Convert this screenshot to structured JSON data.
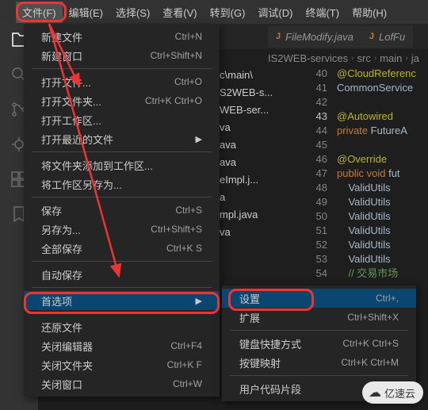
{
  "menubar": {
    "items": [
      "文件(F)",
      "编辑(E)",
      "选择(S)",
      "查看(V)",
      "转到(G)",
      "调试(D)",
      "终端(T)",
      "帮助(H)"
    ]
  },
  "fileMenu": {
    "groups": [
      [
        {
          "label": "新建文件",
          "shortcut": "Ctrl+N"
        },
        {
          "label": "新建窗口",
          "shortcut": "Ctrl+Shift+N"
        }
      ],
      [
        {
          "label": "打开文件...",
          "shortcut": "Ctrl+O"
        },
        {
          "label": "打开文件夹...",
          "shortcut": "Ctrl+K Ctrl+O"
        },
        {
          "label": "打开工作区...",
          "shortcut": ""
        },
        {
          "label": "打开最近的文件",
          "shortcut": "",
          "submenu": true
        }
      ],
      [
        {
          "label": "将文件夹添加到工作区...",
          "shortcut": ""
        },
        {
          "label": "将工作区另存为...",
          "shortcut": ""
        }
      ],
      [
        {
          "label": "保存",
          "shortcut": "Ctrl+S"
        },
        {
          "label": "另存为...",
          "shortcut": "Ctrl+Shift+S"
        },
        {
          "label": "全部保存",
          "shortcut": "Ctrl+K S"
        }
      ],
      [
        {
          "label": "自动保存",
          "shortcut": ""
        }
      ],
      [
        {
          "label": "首选项",
          "shortcut": "",
          "submenu": true,
          "hover": true
        }
      ],
      [
        {
          "label": "还原文件",
          "shortcut": ""
        },
        {
          "label": "关闭编辑器",
          "shortcut": "Ctrl+F4"
        },
        {
          "label": "关闭文件夹",
          "shortcut": "Ctrl+K F"
        },
        {
          "label": "关闭窗口",
          "shortcut": "Ctrl+W"
        }
      ]
    ]
  },
  "preferencesSubmenu": {
    "items": [
      {
        "label": "设置",
        "shortcut": "Ctrl+,",
        "hover": true
      },
      {
        "label": "扩展",
        "shortcut": "Ctrl+Shift+X"
      },
      null,
      {
        "label": "键盘快捷方式",
        "shortcut": "Ctrl+K Ctrl+S"
      },
      {
        "label": "按键映射",
        "shortcut": "Ctrl+K Ctrl+M"
      },
      null,
      {
        "label": "用户代码片段",
        "shortcut": ""
      }
    ]
  },
  "tabs": {
    "items": [
      {
        "label": "FileModify.java",
        "active": false
      },
      {
        "label": "LofFu",
        "active": false
      }
    ]
  },
  "breadcrumb": {
    "segments": [
      "IS2WEB-services",
      "src",
      "main",
      "ja"
    ]
  },
  "explorerPeek": {
    "lines": [
      "c\\main\\",
      "S2WEB-s...",
      "WEB-ser...",
      "",
      "va",
      "ava",
      "ava",
      "eImpl.j...",
      "a",
      "mpl.java",
      "",
      "va"
    ]
  },
  "code": {
    "lines": [
      {
        "n": 40,
        "html": "<span class='annot'>@CloudReferenc</span>"
      },
      {
        "n": 41,
        "html": "<span class='type'>CommonService</span>"
      },
      {
        "n": 42,
        "html": ""
      },
      {
        "n": 43,
        "html": "<span class='annot'>@Autowired</span>",
        "current": true
      },
      {
        "n": 44,
        "html": "<span class='kw'>private</span> <span class='type'>FutureA</span>"
      },
      {
        "n": 45,
        "html": ""
      },
      {
        "n": 46,
        "html": "<span class='annot'>@Override</span>"
      },
      {
        "n": 47,
        "html": "<span class='kw'>public</span> <span class='kw'>void</span> <span class='ident'>fut</span>"
      },
      {
        "n": 48,
        "html": "    <span class='type'>ValidUtils</span>"
      },
      {
        "n": 49,
        "html": "    <span class='type'>ValidUtils</span>"
      },
      {
        "n": 50,
        "html": "    <span class='type'>ValidUtils</span>"
      },
      {
        "n": 51,
        "html": "    <span class='type'>ValidUtils</span>"
      },
      {
        "n": 52,
        "html": "    <span class='type'>ValidUtils</span>"
      },
      {
        "n": 53,
        "html": "    <span class='type'>ValidUtils</span>"
      },
      {
        "n": 54,
        "html": "    <span class='green'>// 交易市场</span>"
      }
    ]
  },
  "watermark": {
    "text": "亿速云"
  }
}
